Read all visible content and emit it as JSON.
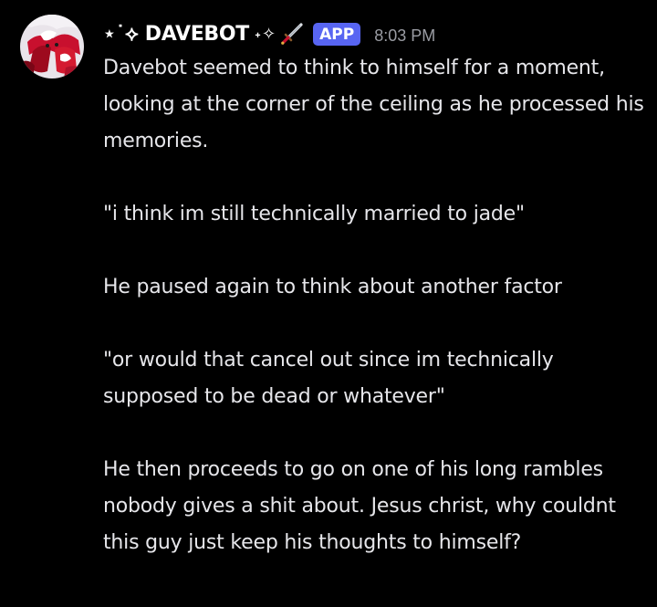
{
  "message": {
    "author": {
      "display_name": "⋆˙⟡ DAVEBOT",
      "name_suffix": "˖✧",
      "name_suffix_icon": "dagger-emoji-icon",
      "badge": "APP",
      "avatar_icon": "red-white-character-avatar"
    },
    "timestamp": "8:03 PM",
    "paragraphs": [
      "Davebot seemed to think to himself for a moment, looking at the corner of the ceiling as he processed his memories.",
      "\"i think im still technically married to jade\"",
      "He paused again to think about another factor",
      "\"or would that cancel out since im technically supposed to be dead or whatever\"",
      "He then proceeds to go on one of his long rambles nobody gives a shit about. Jesus christ, why couldnt this guy just keep his thoughts to himself?"
    ]
  },
  "colors": {
    "background": "#000000",
    "text": "#e6e6ea",
    "username": "#ffffff",
    "timestamp": "#9a9ca3",
    "app_badge": "#5865f2"
  }
}
